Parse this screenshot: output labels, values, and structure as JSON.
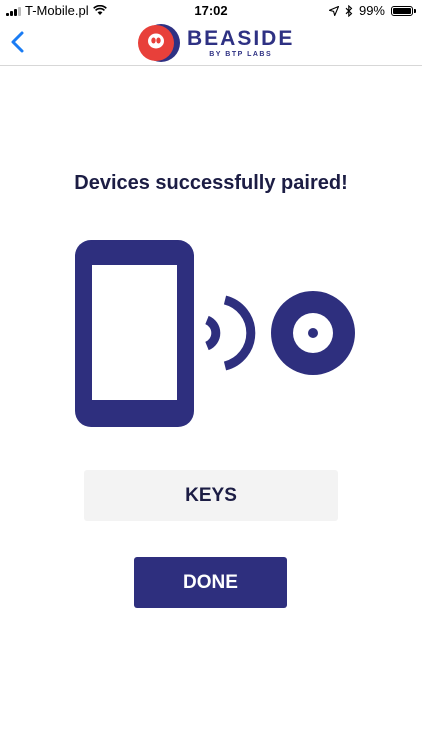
{
  "status_bar": {
    "carrier": "T-Mobile.pl",
    "time": "17:02",
    "battery": "99%",
    "battery_level": 0.99
  },
  "nav": {
    "back_icon": "chevron-left-icon",
    "logo_title": "BEASIDE",
    "logo_subtitle": "BY BTP LABS"
  },
  "main": {
    "heading": "Devices successfully paired!",
    "illustration_icons": [
      "phone-icon",
      "signal-waves-icon",
      "beacon-icon"
    ]
  },
  "buttons": {
    "keys_label": "KEYS",
    "done_label": "DONE"
  },
  "colors": {
    "brand_navy": "#2e2f7e",
    "brand_red": "#e8403a",
    "ios_blue": "#1a7cf4",
    "secondary_button_bg": "#f3f3f3"
  }
}
